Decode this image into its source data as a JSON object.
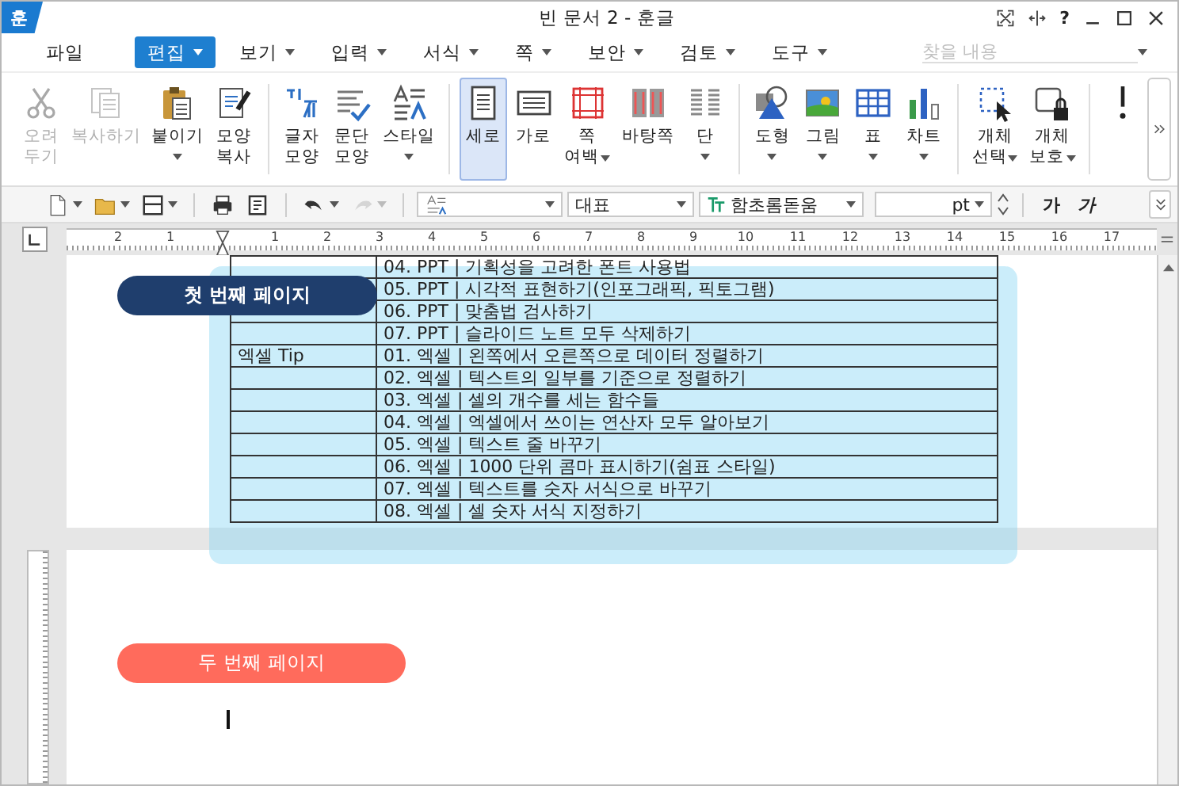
{
  "window": {
    "logo": "훈",
    "title": "빈 문서 2 - 훈글",
    "help_label": "?"
  },
  "menu": [
    {
      "label": "파일",
      "selected": false,
      "dropdown": false
    },
    {
      "label": "편집",
      "selected": true,
      "dropdown": true
    },
    {
      "label": "보기",
      "selected": false,
      "dropdown": true
    },
    {
      "label": "입력",
      "selected": false,
      "dropdown": true
    },
    {
      "label": "서식",
      "selected": false,
      "dropdown": true
    },
    {
      "label": "쪽",
      "selected": false,
      "dropdown": true
    },
    {
      "label": "보안",
      "selected": false,
      "dropdown": true
    },
    {
      "label": "검토",
      "selected": false,
      "dropdown": true
    },
    {
      "label": "도구",
      "selected": false,
      "dropdown": true
    }
  ],
  "search": {
    "placeholder": "찾을 내용"
  },
  "ribbon": [
    {
      "kind": "scissors",
      "lines": [
        "오려",
        "두기"
      ],
      "disabled": true,
      "dropdown": false,
      "selected": false,
      "group_end": false
    },
    {
      "kind": "copy",
      "lines": [
        "복사하기"
      ],
      "disabled": true,
      "dropdown": false,
      "selected": false,
      "group_end": false
    },
    {
      "kind": "paste",
      "lines": [
        "붙이기"
      ],
      "disabled": false,
      "dropdown": true,
      "selected": false,
      "group_end": false
    },
    {
      "kind": "format-copy",
      "lines": [
        "모양",
        "복사"
      ],
      "disabled": false,
      "dropdown": false,
      "selected": false,
      "group_end": true
    },
    {
      "kind": "char-shape",
      "lines": [
        "글자",
        "모양"
      ],
      "disabled": false,
      "dropdown": false,
      "selected": false,
      "group_end": false
    },
    {
      "kind": "para-shape",
      "lines": [
        "문단",
        "모양"
      ],
      "disabled": false,
      "dropdown": false,
      "selected": false,
      "group_end": false
    },
    {
      "kind": "style",
      "lines": [
        "스타일"
      ],
      "disabled": false,
      "dropdown": true,
      "selected": false,
      "group_end": true
    },
    {
      "kind": "portrait",
      "lines": [
        "세로"
      ],
      "disabled": false,
      "dropdown": false,
      "selected": true,
      "group_end": false
    },
    {
      "kind": "landscape",
      "lines": [
        "가로"
      ],
      "disabled": false,
      "dropdown": false,
      "selected": false,
      "group_end": false
    },
    {
      "kind": "margins",
      "lines": [
        "쪽",
        "여백"
      ],
      "disabled": false,
      "dropdown": true,
      "selected": false,
      "group_end": false
    },
    {
      "kind": "master-page",
      "lines": [
        "바탕쪽"
      ],
      "disabled": false,
      "dropdown": false,
      "selected": false,
      "group_end": false
    },
    {
      "kind": "columns",
      "lines": [
        "단"
      ],
      "disabled": false,
      "dropdown": true,
      "selected": false,
      "group_end": true
    },
    {
      "kind": "shape",
      "lines": [
        "도형"
      ],
      "disabled": false,
      "dropdown": true,
      "selected": false,
      "group_end": false
    },
    {
      "kind": "picture",
      "lines": [
        "그림"
      ],
      "disabled": false,
      "dropdown": true,
      "selected": false,
      "group_end": false
    },
    {
      "kind": "table",
      "lines": [
        "표"
      ],
      "disabled": false,
      "dropdown": true,
      "selected": false,
      "group_end": false
    },
    {
      "kind": "chart",
      "lines": [
        "차트"
      ],
      "disabled": false,
      "dropdown": true,
      "selected": false,
      "group_end": true
    },
    {
      "kind": "select",
      "lines": [
        "개체",
        "선택"
      ],
      "disabled": false,
      "dropdown": true,
      "selected": false,
      "group_end": false
    },
    {
      "kind": "protect",
      "lines": [
        "개체",
        "보호"
      ],
      "disabled": false,
      "dropdown": true,
      "selected": false,
      "group_end": true
    },
    {
      "kind": "info",
      "selected": false
    }
  ],
  "toolbar": {
    "groups": [
      [
        {
          "kind": "new-doc",
          "dropdown": true,
          "disabled": false
        },
        {
          "kind": "folder",
          "dropdown": true,
          "disabled": false
        },
        {
          "kind": "save",
          "dropdown": true,
          "disabled": false
        }
      ],
      [
        {
          "kind": "print",
          "dropdown": false,
          "disabled": false
        },
        {
          "kind": "preview",
          "dropdown": false,
          "disabled": false
        }
      ],
      [
        {
          "kind": "undo",
          "dropdown": true,
          "disabled": false
        },
        {
          "kind": "redo",
          "dropdown": true,
          "disabled": true
        }
      ]
    ],
    "paragraph_style": "대표",
    "font": "함초롬돋움",
    "size_unit": "pt",
    "bold_label": "가",
    "italic_label": "가"
  },
  "ruler": {
    "left_labels": [
      "2",
      "1"
    ],
    "labels": [
      "1",
      "2",
      "3",
      "4",
      "5",
      "6",
      "7",
      "8",
      "9",
      "10",
      "11",
      "12",
      "13",
      "14",
      "15",
      "16",
      "17"
    ]
  },
  "table": {
    "rows": [
      {
        "category": "",
        "item": "04. PPT | 기획성을 고려한 폰트 사용법"
      },
      {
        "category": "",
        "item": "05. PPT | 시각적 표현하기(인포그래픽, 픽토그램)"
      },
      {
        "category": "",
        "item": "06. PPT | 맞춤법 검사하기"
      },
      {
        "category": "",
        "item": "07. PPT | 슬라이드 노트 모두 삭제하기"
      },
      {
        "category": "엑셀 Tip",
        "item": "01. 엑셀 | 왼쪽에서 오른쪽으로 데이터 정렬하기"
      },
      {
        "category": "",
        "item": "02. 엑셀 | 텍스트의 일부를 기준으로 정렬하기"
      },
      {
        "category": "",
        "item": "03. 엑셀 | 셀의 개수를 세는 함수들"
      },
      {
        "category": "",
        "item": "04. 엑셀 | 엑셀에서 쓰이는 연산자 모두 알아보기"
      },
      {
        "category": "",
        "item": "05. 엑셀 | 텍스트 줄 바꾸기"
      },
      {
        "category": "",
        "item": "06. 엑셀 | 1000 단위 콤마 표시하기(쉼표 스타일)"
      },
      {
        "category": "",
        "item": "07. 엑셀 | 텍스트를 숫자 서식으로 바꾸기"
      },
      {
        "category": "",
        "item": "08. 엑셀 | 셀 숫자 서식 지정하기"
      }
    ]
  },
  "badges": [
    {
      "label": "첫 번째 페이지",
      "color": "#1f3e6d"
    },
    {
      "label": "두 번째 페이지",
      "color": "#ff6b5c"
    }
  ]
}
